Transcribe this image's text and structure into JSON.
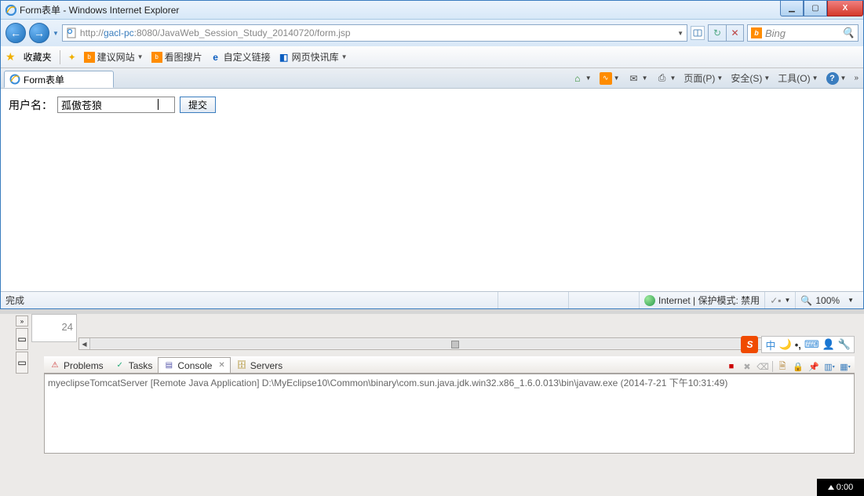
{
  "window": {
    "title": "Form表单 - Windows Internet Explorer"
  },
  "nav": {
    "url_pre": "http://",
    "url_host": "gacl-pc",
    "url_port": ":8080",
    "url_path": "/JavaWeb_Session_Study_20140720/form.jsp"
  },
  "search": {
    "engine_label": "Bing",
    "bing_b": "b"
  },
  "favorites": {
    "label": "收藏夹",
    "items": [
      {
        "label": "建议网站",
        "dropdown": true
      },
      {
        "label": "看图搜片"
      },
      {
        "label": "自定义链接"
      },
      {
        "label": "网页快讯库",
        "dropdown": true
      }
    ]
  },
  "tab": {
    "label": "Form表单"
  },
  "toolbar": {
    "page": "页面(P)",
    "safety": "安全(S)",
    "tools": "工具(O)"
  },
  "form": {
    "label": "用户名：",
    "value": "孤傲苍狼",
    "submit": "提交"
  },
  "status": {
    "done": "完成",
    "zone": "Internet | 保护模式: 禁用",
    "zoom": "100%"
  },
  "eclipse": {
    "line_no": "24",
    "tabs": {
      "problems": "Problems",
      "tasks": "Tasks",
      "console": "Console",
      "servers": "Servers"
    },
    "console_text": "myeclipseTomcatServer [Remote Java Application] D:\\MyEclipse10\\Common\\binary\\com.sun.java.jdk.win32.x86_1.6.0.013\\bin\\javaw.exe (2014-7-21 下午10:31:49)"
  },
  "ime": {
    "cn": "中"
  },
  "taskbar": {
    "time": "0:00"
  }
}
